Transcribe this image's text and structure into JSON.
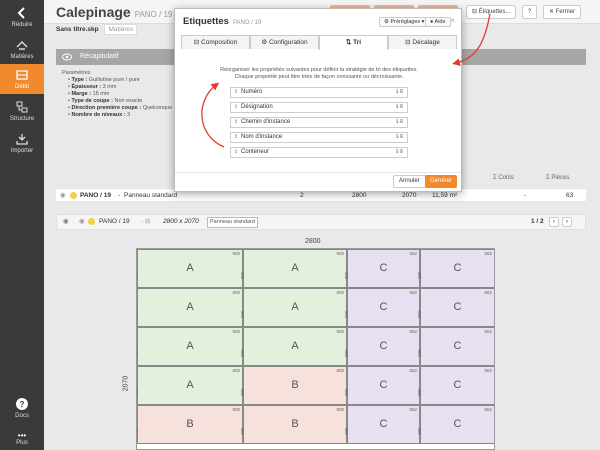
{
  "sidebar": {
    "items": [
      {
        "label": "Réduire",
        "icon": "chevron-left-icon"
      },
      {
        "label": "Matières",
        "icon": "materials-icon"
      },
      {
        "label": "Débit",
        "icon": "cutting-icon"
      },
      {
        "label": "Structure",
        "icon": "structure-icon"
      },
      {
        "label": "Importer",
        "icon": "import-icon"
      },
      {
        "label": "Docs",
        "icon": "help-icon"
      },
      {
        "label": "Plus",
        "icon": "more-icon"
      }
    ]
  },
  "header": {
    "title": "Calepinage",
    "subtitle": "PANO / 19",
    "btn_etiquettes": "Étiquettes...",
    "btn_help": "?",
    "btn_close": "Fermer"
  },
  "file": {
    "name": "Sans titre.skp",
    "tag": "Matières"
  },
  "recap": {
    "title": "Récapitulatif"
  },
  "params": {
    "heading": "Paramètres",
    "type": {
      "k": "Type :",
      "v": "Guillotine pure / pure"
    },
    "epaisseur": {
      "k": "Épaisseur :",
      "v": "3 mm"
    },
    "marge": {
      "k": "Marge :",
      "v": "15 mm"
    },
    "type_coupe": {
      "k": "Type de coupe :",
      "v": "Non exacte"
    },
    "direction": {
      "k": "Direction première coupe :",
      "v": "Quelconque"
    },
    "niveaux": {
      "k": "Nombre de niveaux :",
      "v": "3"
    }
  },
  "table": {
    "col_couts": "Σ Coûts",
    "col_pieces": "Σ Pièces",
    "row": {
      "name": "PANO / 19",
      "desc": "Panneau standard",
      "qty": "2",
      "w": "2800",
      "h": "2070",
      "area": "11,59 m²",
      "cost": "-",
      "pieces": "63"
    }
  },
  "panel": {
    "name": "PANO / 19",
    "dims": "2800 x 2070",
    "badge": "Panneau standard",
    "pager": "1 / 2",
    "width_label": "2800",
    "height_label": "2070"
  },
  "sheet_cells": [
    {
      "lbl": "A",
      "w": "900",
      "h": "300",
      "type": "A"
    },
    {
      "lbl": "A",
      "w": "900",
      "h": "300",
      "type": "A"
    },
    {
      "lbl": "C",
      "w": "562",
      "h": "300",
      "type": "C"
    },
    {
      "lbl": "C",
      "w": "562",
      "h": "300",
      "type": "C"
    },
    {
      "lbl": "A",
      "w": "900",
      "h": "300",
      "type": "A"
    },
    {
      "lbl": "A",
      "w": "900",
      "h": "300",
      "type": "A"
    },
    {
      "lbl": "C",
      "w": "562",
      "h": "300",
      "type": "C"
    },
    {
      "lbl": "C",
      "w": "562",
      "h": "300",
      "type": "C"
    },
    {
      "lbl": "A",
      "w": "900",
      "h": "300",
      "type": "A"
    },
    {
      "lbl": "A",
      "w": "900",
      "h": "300",
      "type": "A"
    },
    {
      "lbl": "C",
      "w": "562",
      "h": "300",
      "type": "C"
    },
    {
      "lbl": "C",
      "w": "562",
      "h": "300",
      "type": "C"
    },
    {
      "lbl": "A",
      "w": "900",
      "h": "300",
      "type": "A"
    },
    {
      "lbl": "B",
      "w": "900",
      "h": "300",
      "type": "B"
    },
    {
      "lbl": "C",
      "w": "562",
      "h": "300",
      "type": "C"
    },
    {
      "lbl": "C",
      "w": "562",
      "h": "300",
      "type": "C"
    },
    {
      "lbl": "B",
      "w": "900",
      "h": "300",
      "type": "B"
    },
    {
      "lbl": "B",
      "w": "900",
      "h": "300",
      "type": "B"
    },
    {
      "lbl": "C",
      "w": "562",
      "h": "300",
      "type": "C"
    },
    {
      "lbl": "C",
      "w": "562",
      "h": "300",
      "type": "C"
    }
  ],
  "colors": {
    "A": "#e3f1dc",
    "B": "#f6e1dd",
    "C": "#e6e0f0",
    "accent": "#f08a2c"
  },
  "dialog": {
    "title": "Etiquettes",
    "subtitle": "PANO / 19",
    "presets": "Préréglages",
    "aide": "Aide",
    "close": "×",
    "tabs": [
      "Composition",
      "Configuration",
      "Tri",
      "Décalage"
    ],
    "help1": "Réorganiser les propriétés suivantes pour définir la stratégie de tri des étiquettes.",
    "help2": "Chaque propriété peut être triée de façon croissante ou décroissante.",
    "sort_items": [
      "Numéro",
      "Désignation",
      "Chemin d'instance",
      "Nom d'instance",
      "Conteneur"
    ],
    "cancel": "Annuler",
    "generate": "Générer"
  }
}
